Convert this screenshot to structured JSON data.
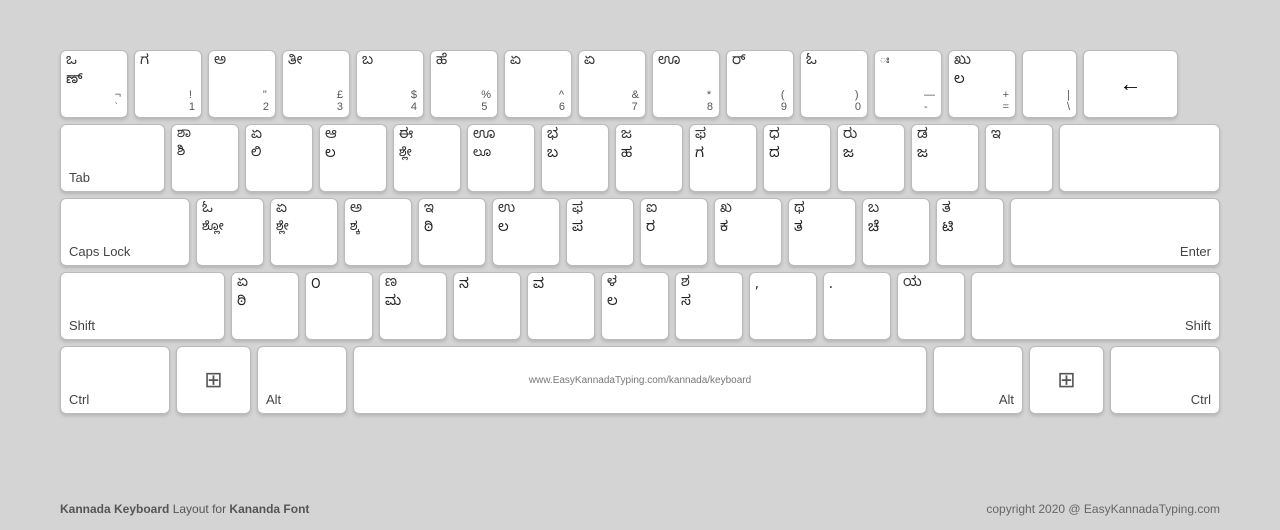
{
  "keyboard": {
    "title": "Kannada Keyboard",
    "subtitle": "Layout for",
    "font": "Kananda Font",
    "copyright": "copyright 2020 @ EasyKannadaTyping.com",
    "url": "www.EasyKannadaTyping.com/kannada/keyboard",
    "rows": [
      {
        "id": "row1",
        "keys": [
          {
            "id": "backtick",
            "top": "ಒ",
            "bottom": "ಣ್",
            "shift": "¬",
            "base": "`"
          },
          {
            "id": "1",
            "top": "ಗ",
            "bottom": "",
            "shift": "!",
            "base": "1"
          },
          {
            "id": "2",
            "top": "ಅ",
            "bottom": "",
            "shift": "\"",
            "base": "2"
          },
          {
            "id": "3",
            "top": "ತೀ",
            "bottom": "",
            "shift": "£",
            "base": "3"
          },
          {
            "id": "4",
            "top": "ಬ",
            "bottom": "",
            "shift": "$",
            "base": "4"
          },
          {
            "id": "5",
            "top": "ಹೆ",
            "bottom": "",
            "shift": "%",
            "base": "5"
          },
          {
            "id": "6",
            "top": "ಏ",
            "bottom": "",
            "shift": "^",
            "base": "6"
          },
          {
            "id": "7",
            "top": "ಏ",
            "bottom": "",
            "shift": "&",
            "base": "7"
          },
          {
            "id": "8",
            "top": "ಊ",
            "bottom": "",
            "shift": "*",
            "base": "8"
          },
          {
            "id": "9",
            "top": "ರ್",
            "bottom": "",
            "shift": "(",
            "base": "9"
          },
          {
            "id": "0",
            "top": "ಓ",
            "bottom": "",
            "shift": ")",
            "base": "0"
          },
          {
            "id": "minus",
            "top": "",
            "bottom": "",
            "shift": "ಃ",
            "base": "-",
            "extra": "—"
          },
          {
            "id": "equals",
            "top": "ಲ",
            "bottom": "",
            "shift": "ಖು",
            "base": "=",
            "extra": "+"
          },
          {
            "id": "pipe",
            "top": "",
            "bottom": "",
            "shift": "|",
            "base": "\\"
          },
          {
            "id": "backspace",
            "label": "←",
            "type": "backspace"
          }
        ]
      },
      {
        "id": "row2",
        "keys": [
          {
            "id": "tab",
            "label": "Tab",
            "type": "wide-tab"
          },
          {
            "id": "q",
            "top": "ಶಾ",
            "bottom": "ಶಿ",
            "shift": ""
          },
          {
            "id": "w",
            "top": "ಏ",
            "bottom": "ಲಿ",
            "shift": ""
          },
          {
            "id": "e",
            "top": "ಆ",
            "bottom": "ಲ",
            "shift": ""
          },
          {
            "id": "r",
            "top": "ಈ",
            "bottom": "ಶ್ಲೇ",
            "shift": ""
          },
          {
            "id": "t",
            "top": "ಊ",
            "bottom": "ಲೂ",
            "shift": ""
          },
          {
            "id": "y",
            "top": "ಭ",
            "bottom": "ಬ",
            "shift": ""
          },
          {
            "id": "u",
            "top": "ಜ",
            "bottom": "ಹ",
            "shift": ""
          },
          {
            "id": "i",
            "top": "ಫ",
            "bottom": "ಗ",
            "shift": ""
          },
          {
            "id": "o",
            "top": "ಧ",
            "bottom": "ದ",
            "shift": ""
          },
          {
            "id": "p",
            "top": "ರು",
            "bottom": "ಜ",
            "shift": ""
          },
          {
            "id": "bracket-l",
            "top": "ಡ",
            "bottom": "ಜ",
            "shift": ""
          },
          {
            "id": "bracket-r",
            "top": "ಇ",
            "bottom": "",
            "shift": ""
          },
          {
            "id": "enter-top",
            "label": "",
            "type": "enter-top"
          }
        ]
      },
      {
        "id": "row3",
        "keys": [
          {
            "id": "capslock",
            "label": "Caps Lock",
            "type": "wide-caps"
          },
          {
            "id": "a",
            "top": "ಓ",
            "bottom": "ಶ್ಲೋ",
            "shift": ""
          },
          {
            "id": "s",
            "top": "ಏ",
            "bottom": "ಶ್ಲೇ",
            "shift": ""
          },
          {
            "id": "d",
            "top": "ಅ",
            "bottom": "ಶ್ಕ",
            "shift": ""
          },
          {
            "id": "f",
            "top": "ಇ",
            "bottom": "ಠಿ",
            "shift": ""
          },
          {
            "id": "g",
            "top": "ಉ",
            "bottom": "ಲ",
            "shift": ""
          },
          {
            "id": "h",
            "top": "ಫ",
            "bottom": "ಪ",
            "shift": ""
          },
          {
            "id": "j",
            "top": "ಐ",
            "bottom": "ರ",
            "shift": ""
          },
          {
            "id": "k",
            "top": "ಖ",
            "bottom": "ಕ",
            "shift": ""
          },
          {
            "id": "l",
            "top": "ಥ",
            "bottom": "ತ",
            "shift": ""
          },
          {
            "id": "semi",
            "top": "ಬ",
            "bottom": "ಚೆ",
            "shift": ""
          },
          {
            "id": "quote",
            "top": "ತ",
            "bottom": "ಟಿ",
            "shift": ""
          },
          {
            "id": "enter",
            "label": "Enter",
            "type": "wide-enter"
          }
        ]
      },
      {
        "id": "row4",
        "keys": [
          {
            "id": "shift-l",
            "label": "Shift",
            "type": "wide-shift-l"
          },
          {
            "id": "z",
            "top": "ಏ",
            "bottom": "ಠಿ",
            "shift": ""
          },
          {
            "id": "x",
            "top": "",
            "bottom": "೦",
            "shift": ""
          },
          {
            "id": "c",
            "top": "ಣ",
            "bottom": "ಮ",
            "shift": ""
          },
          {
            "id": "v",
            "top": "",
            "bottom": "ನ",
            "shift": ""
          },
          {
            "id": "b",
            "top": "",
            "bottom": "ವ",
            "shift": ""
          },
          {
            "id": "n",
            "top": "ಳ",
            "bottom": "ಲ",
            "shift": ""
          },
          {
            "id": "m",
            "top": "ಶ",
            "bottom": "ಸ",
            "shift": ""
          },
          {
            "id": "comma",
            "top": "",
            "bottom": ",",
            "shift": ""
          },
          {
            "id": "period",
            "top": "",
            "bottom": ".",
            "shift": ""
          },
          {
            "id": "slash",
            "top": "ಯ",
            "bottom": "",
            "shift": ""
          },
          {
            "id": "shift-r",
            "label": "Shift",
            "type": "wide-shift-r"
          }
        ]
      },
      {
        "id": "row5",
        "keys": [
          {
            "id": "ctrl-l",
            "label": "Ctrl",
            "type": "ctrl"
          },
          {
            "id": "win-l",
            "label": "⊞",
            "type": "win"
          },
          {
            "id": "alt-l",
            "label": "Alt",
            "type": "alt"
          },
          {
            "id": "space",
            "label": "www.EasyKannadaTyping.com/kannada/keyboard",
            "type": "space"
          },
          {
            "id": "alt-r",
            "label": "Alt",
            "type": "alt"
          },
          {
            "id": "win-r",
            "label": "⊞",
            "type": "win"
          },
          {
            "id": "ctrl-r",
            "label": "Ctrl",
            "type": "ctrl"
          }
        ]
      }
    ]
  }
}
